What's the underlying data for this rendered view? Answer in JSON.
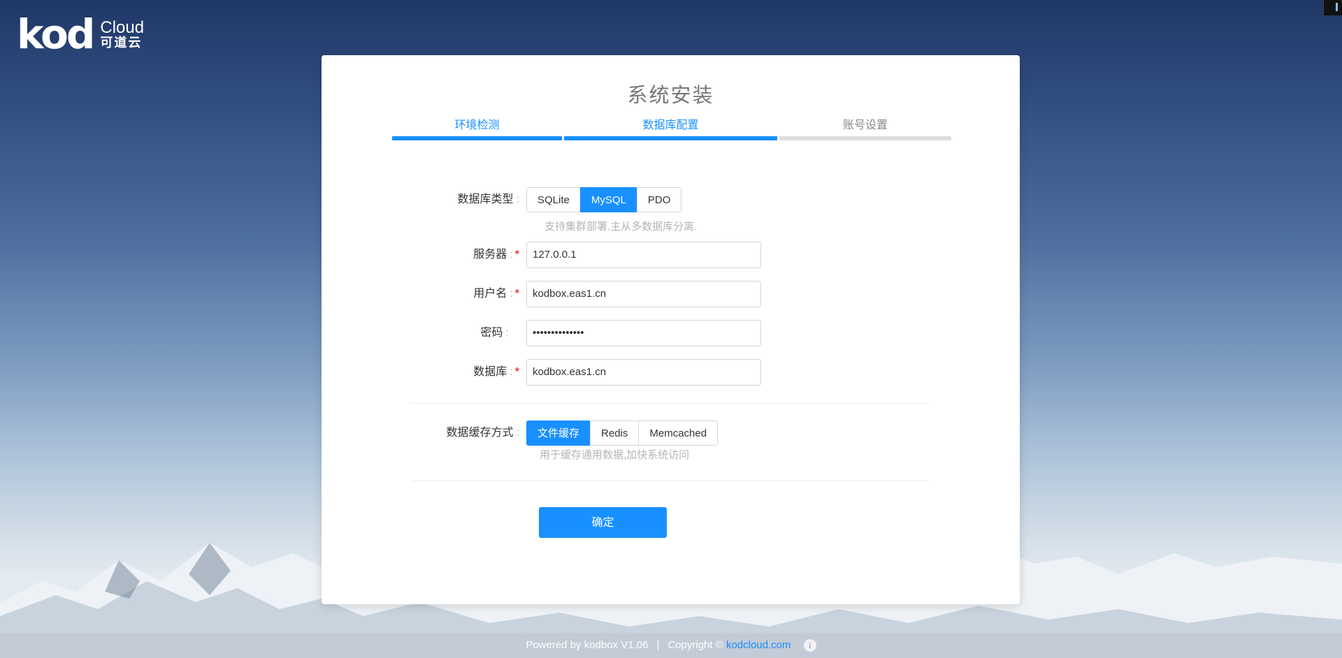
{
  "logo": {
    "mark": "kod",
    "name": "Cloud",
    "subtitle": "可道云"
  },
  "card": {
    "title": "系统安装",
    "steps": [
      {
        "label": "环境检测",
        "state": "done"
      },
      {
        "label": "数据库配置",
        "state": "active"
      },
      {
        "label": "账号设置",
        "state": "todo"
      }
    ]
  },
  "form": {
    "db_type": {
      "label": "数据库类型",
      "options": [
        "SQLite",
        "MySQL",
        "PDO"
      ],
      "selected": "MySQL",
      "hint": "支持集群部署,主从多数据库分离."
    },
    "server": {
      "label": "服务器",
      "value": "127.0.0.1",
      "required": true
    },
    "username": {
      "label": "用户名",
      "value": "kodbox.eas1.cn",
      "required": true
    },
    "password": {
      "label": "密码",
      "value": "••••••••••••••",
      "required": false
    },
    "database": {
      "label": "数据库",
      "value": "kodbox.eas1.cn",
      "required": true
    },
    "cache": {
      "label": "数据缓存方式",
      "options": [
        "文件缓存",
        "Redis",
        "Memcached"
      ],
      "selected": "文件缓存",
      "hint": "用于缓存通用数据,加快系统访问"
    },
    "confirm_label": "确定"
  },
  "footer": {
    "powered": "Powered by kodbox V1.06",
    "separator": "|",
    "copyright": "Copyright ©",
    "link": "kodcloud.com",
    "info_icon": "i"
  },
  "colors": {
    "accent": "#1890ff",
    "required": "#e64340"
  }
}
